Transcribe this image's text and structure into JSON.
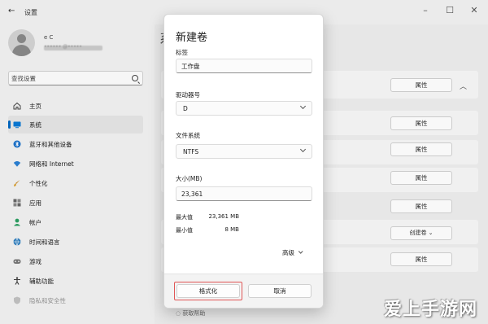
{
  "window": {
    "title": "设置",
    "back_icon": "arrow-left-icon",
    "controls": [
      "minimize-icon",
      "maximize-icon",
      "close-icon"
    ]
  },
  "sidebar": {
    "user": {
      "name": "e C",
      "email": "•••••• @•••••"
    },
    "search": {
      "placeholder": "查找设置",
      "icon": "search-icon"
    },
    "items": [
      {
        "label": "主页",
        "icon": "home-icon",
        "selected": false
      },
      {
        "label": "系统",
        "icon": "system-icon",
        "selected": true
      },
      {
        "label": "蓝牙和其他设备",
        "icon": "bluetooth-icon",
        "selected": false
      },
      {
        "label": "网络和 Internet",
        "icon": "wifi-icon",
        "selected": false
      },
      {
        "label": "个性化",
        "icon": "brush-icon",
        "selected": false
      },
      {
        "label": "应用",
        "icon": "apps-icon",
        "selected": false
      },
      {
        "label": "帐户",
        "icon": "account-icon",
        "selected": false
      },
      {
        "label": "时间和语言",
        "icon": "globe-icon",
        "selected": false
      },
      {
        "label": "游戏",
        "icon": "gamepad-icon",
        "selected": false
      },
      {
        "label": "辅助功能",
        "icon": "accessibility-icon",
        "selected": false
      },
      {
        "label": "隐私和安全性",
        "icon": "shield-icon",
        "selected": false
      }
    ]
  },
  "right_pane": {
    "heading_partial": "系",
    "property_button": "属性",
    "create_volume_button": "创建卷",
    "bottom_link": "获取帮助"
  },
  "dialog": {
    "title": "新建卷",
    "label_field": {
      "label": "标签",
      "value": "工作盘"
    },
    "drive_letter": {
      "label": "驱动器号",
      "value": "D"
    },
    "file_system": {
      "label": "文件系统",
      "value": "NTFS"
    },
    "size": {
      "label": "大小(MB)",
      "value": "23,361"
    },
    "max": {
      "label": "最大值",
      "value": "23,361 MB"
    },
    "min": {
      "label": "最小值",
      "value": "8 MB"
    },
    "advanced": "高级",
    "format_button": "格式化",
    "cancel_button": "取消"
  },
  "colors": {
    "accent": "#0067c0",
    "highlight_box": "#e05656"
  },
  "watermark": "爱上手游网"
}
